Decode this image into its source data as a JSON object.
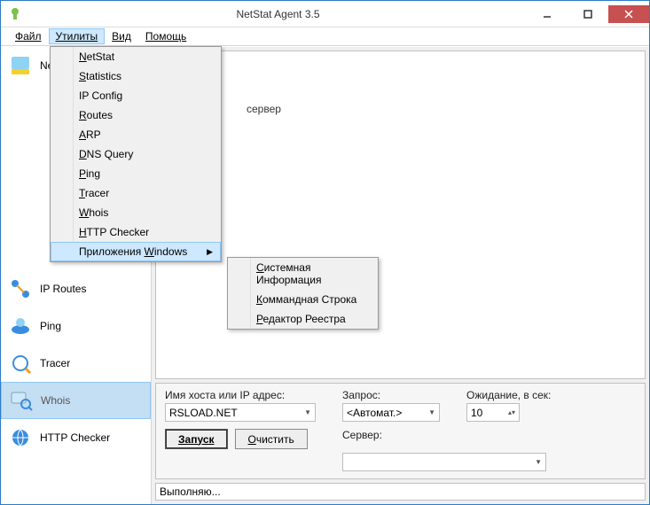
{
  "window": {
    "title": "NetStat Agent 3.5"
  },
  "menubar": {
    "file": "Файл",
    "utils": "Утилиты",
    "view": "Вид",
    "help": "Помощь"
  },
  "utilsMenu": {
    "netstat": "NetStat",
    "statistics": "Statistics",
    "ipconfig": "IP Config",
    "routes": "Routes",
    "arp": "ARP",
    "dnsquery": "DNS Query",
    "ping": "Ping",
    "tracer": "Tracer",
    "whois": "Whois",
    "httpchecker": "HTTP Checker",
    "winapps": "Приложения Windows"
  },
  "submenu": {
    "sysinfo": "Системная Информация",
    "cmdline": "Коммандная Строка",
    "regedit": "Редактор Реестра"
  },
  "sidebar": {
    "netstat": "NetStat",
    "iproutes": "IP Routes",
    "ping": "Ping",
    "tracer": "Tracer",
    "whois": "Whois",
    "httpchecker": "HTTP Checker"
  },
  "output": {
    "server_hint": "сервер"
  },
  "form": {
    "host_label": "Имя хоста или IP адрес:",
    "host_value": "RSLOAD.NET",
    "query_label": "Запрос:",
    "query_value": "<Автомат.>",
    "wait_label": "Ожидание, в сек:",
    "wait_value": "10",
    "server_label": "Сервер:",
    "server_value": "",
    "run": "Запуск",
    "clear": "Очистить"
  },
  "status": {
    "text": "Выполняю..."
  }
}
